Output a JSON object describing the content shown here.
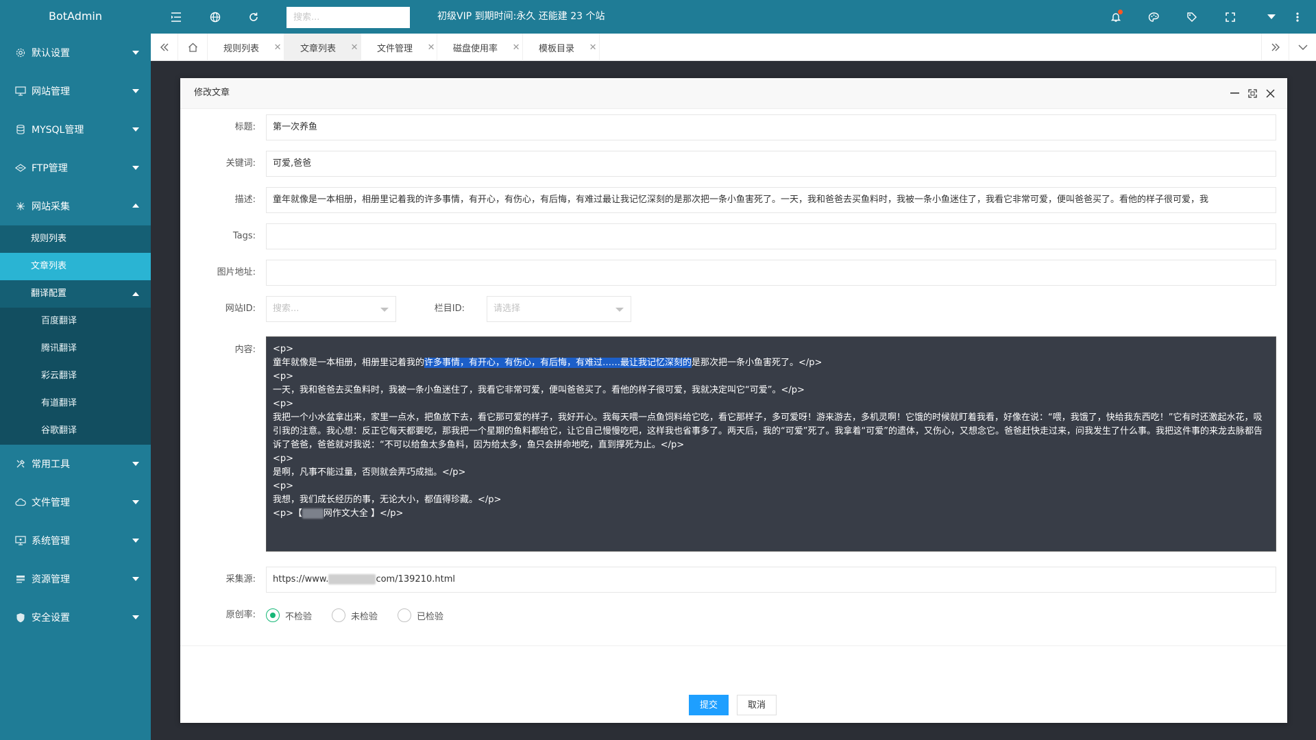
{
  "topbar": {
    "brand": "BotAdmin",
    "search_placeholder": "搜索...",
    "vip_text": "初级VIP 到期时间:永久 还能建 23 个站"
  },
  "sidebar": {
    "items": [
      {
        "label": "默认设置",
        "icon": "gear-icon"
      },
      {
        "label": "网站管理",
        "icon": "monitor-icon"
      },
      {
        "label": "MYSQL管理",
        "icon": "database-icon"
      },
      {
        "label": "FTP管理",
        "icon": "ftp-icon"
      },
      {
        "label": "网站采集",
        "icon": "spider-icon"
      }
    ],
    "collect_sub": [
      "规则列表",
      "文章列表"
    ],
    "translate_group": "翻译配置",
    "translate_sub": [
      "百度翻译",
      "腾讯翻译",
      "彩云翻译",
      "有道翻译",
      "谷歌翻译"
    ],
    "bottom_items": [
      {
        "label": "常用工具",
        "icon": "tools-icon"
      },
      {
        "label": "文件管理",
        "icon": "cloud-icon"
      },
      {
        "label": "系统管理",
        "icon": "monitor-icon"
      },
      {
        "label": "资源管理",
        "icon": "stack-icon"
      },
      {
        "label": "安全设置",
        "icon": "shield-icon"
      }
    ]
  },
  "tabs": [
    "规则列表",
    "文章列表",
    "文件管理",
    "磁盘使用率",
    "模板目录"
  ],
  "active_tab": "文章列表",
  "modal": {
    "title": "修改文章",
    "labels": {
      "title": "标题:",
      "keywords": "关键词:",
      "description": "描述:",
      "tags": "Tags:",
      "image": "图片地址:",
      "site_id": "网站ID:",
      "column_id": "栏目ID:",
      "content": "内容:",
      "source": "采集源:",
      "originality": "原创率:"
    },
    "values": {
      "title": "第一次养鱼",
      "keywords": "可爱,爸爸",
      "description": "童年就像是一本相册，相册里记着我的许多事情，有开心，有伤心，有后悔，有难过最让我记忆深刻的是那次把一条小鱼害死了。一天，我和爸爸去买鱼料时，我被一条小鱼迷住了，我看它非常可爱，便叫爸爸买了。看他的样子很可爱，我",
      "tags": "",
      "image": "",
      "site_id_placeholder": "搜索...",
      "column_id_placeholder": "请选择",
      "source_prefix": "https://www.",
      "source_suffix": "com/139210.html"
    },
    "content": {
      "line1": "<p>",
      "line2_a": "童年就像是一本相册，相册里记着我的",
      "line2_hl": "许多事情，有开心，有伤心，有后悔，有难过……最让我记忆深刻的",
      "line2_b": "是那次把一条小鱼害死了。</p>",
      "line3": "<p>",
      "line4": "一天，我和爸爸去买鱼料时，我被一条小鱼迷住了，我看它非常可爱，便叫爸爸买了。看他的样子很可爱，我就决定叫它“可爱”。</p>",
      "line5": "<p>",
      "line6": "我把一个小水盆拿出来，家里一点水，把鱼放下去，看它那可爱的样子，我好开心。我每天喂一点鱼饲料给它吃，看它那样子，多可爱呀！游来游去，多机灵啊！它饿的时候就盯着我看，好像在说：“喂，我饿了，快给我东西吃！”它有时还激起水花，吸引我的注意。我心想：反正它每天都要吃，那我把一个星期的鱼料都给它，让它自己慢慢吃吧，这样我也省事多了。两天后，我的“可爱”死了。我拿着“可爱”的遗体，又伤心，又想念它。爸爸赶快走过来，问我发生了什么事。我把这件事的来龙去脉都告诉了爸爸，爸爸就对我说：“不可以给鱼太多鱼料，因为给太多，鱼只会拼命地吃，直到撑死为止。</p>",
      "line7": "<p>",
      "line8": "是啊，凡事不能过量，否则就会弄巧成拙。</p>",
      "line9": "<p>",
      "line10": "我想，我们成长经历的事，无论大小，都值得珍藏。</p>",
      "line11_a": "<p>【",
      "line11_b": "网作文大全 】</p>"
    },
    "radios": [
      "不检验",
      "未检验",
      "已检验"
    ],
    "radio_selected": 0,
    "submit": "提交",
    "cancel": "取消"
  },
  "colors": {
    "topbar": "#1f7c96",
    "sidebar": "#1f7c96",
    "sidebar_active": "#2ab4d3",
    "primary_button": "#1e9fff",
    "radio_checked": "#16b777",
    "editor_bg": "#383d47"
  }
}
